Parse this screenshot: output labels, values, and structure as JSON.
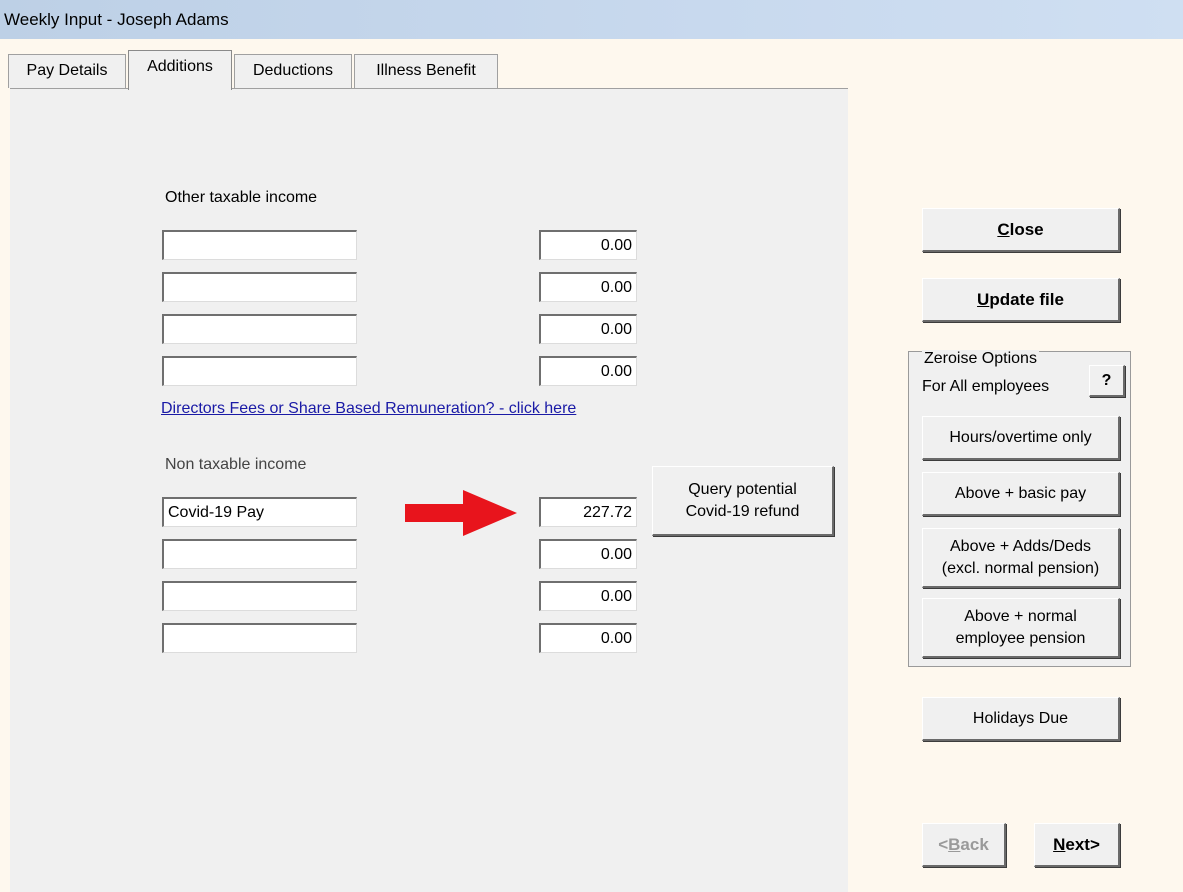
{
  "window": {
    "title": "Weekly Input - Joseph Adams"
  },
  "tabs": [
    {
      "label": "Pay Details"
    },
    {
      "label": "Additions"
    },
    {
      "label": "Deductions"
    },
    {
      "label": "Illness Benefit"
    }
  ],
  "taxable": {
    "heading": "Other taxable income",
    "rows": [
      {
        "desc": "",
        "amount": "0.00"
      },
      {
        "desc": "",
        "amount": "0.00"
      },
      {
        "desc": "",
        "amount": "0.00"
      },
      {
        "desc": "",
        "amount": "0.00"
      }
    ]
  },
  "directors_link": "Directors Fees or Share Based Remuneration? - click here",
  "non_taxable": {
    "heading": "Non taxable income",
    "rows": [
      {
        "desc": "Covid-19 Pay",
        "amount": "227.72"
      },
      {
        "desc": "",
        "amount": "0.00"
      },
      {
        "desc": "",
        "amount": "0.00"
      },
      {
        "desc": "",
        "amount": "0.00"
      }
    ]
  },
  "query_button": {
    "line1": "Query potential",
    "line2": "Covid-19 refund"
  },
  "side": {
    "close": {
      "key": "C",
      "rest": "lose"
    },
    "update": {
      "key": "U",
      "rest": "pdate file"
    },
    "zeroise": {
      "legend": "Zeroise Options",
      "subtitle": "For All employees",
      "help": "?",
      "hours": "Hours/overtime only",
      "basic": "Above + basic pay",
      "adds_line1": "Above + Adds/Deds",
      "adds_line2": "(excl. normal pension)",
      "pension_line1": "Above + normal",
      "pension_line2": "employee pension"
    },
    "holidays": "Holidays Due"
  },
  "nav": {
    "back": {
      "pre": "<",
      "key": "B",
      "rest": "ack"
    },
    "next": {
      "key": "N",
      "rest": "ext>"
    }
  },
  "colors": {
    "arrow": "#e8141c",
    "link": "#1a1aa6"
  }
}
